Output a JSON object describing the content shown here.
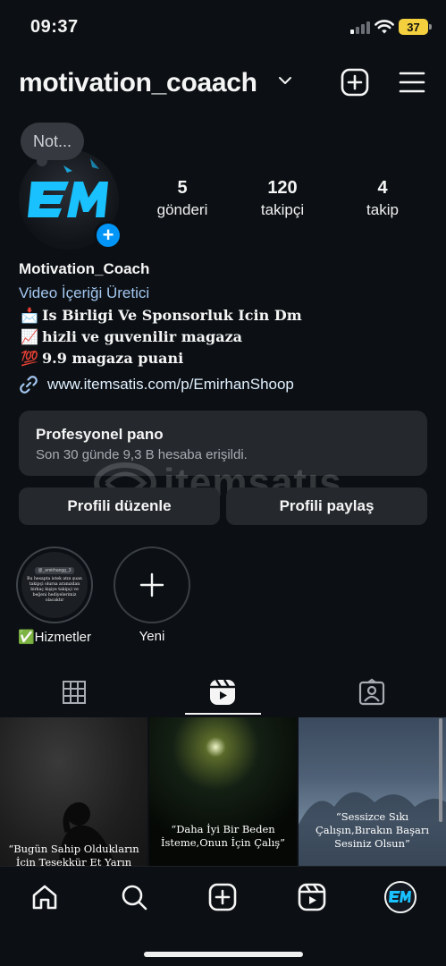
{
  "status_bar": {
    "time": "09:37",
    "battery": "37"
  },
  "header": {
    "username": "motivation_coaach"
  },
  "profile": {
    "note": "Not...",
    "avatar_text": "EM",
    "stats": [
      {
        "value": "5",
        "label": "gönderi"
      },
      {
        "value": "120",
        "label": "takipçi"
      },
      {
        "value": "4",
        "label": "takip"
      }
    ],
    "name": "Motivation_Coach",
    "category": "Video İçeriği Üretici",
    "bio_lines": [
      {
        "emoji": "📩",
        "text": "Is Birligi Ve Sponsorluk Icin Dm"
      },
      {
        "emoji": "📈",
        "text": "hizli ve guvenilir magaza"
      },
      {
        "emoji": "💯",
        "text": "9.9 magaza puani"
      }
    ],
    "link": "www.itemsatis.com/p/EmirhanShoop"
  },
  "dashboard": {
    "title": "Profesyonel pano",
    "subtitle": "Son 30 günde 9,3 B hesaba erişildi."
  },
  "buttons": {
    "edit": "Profili düzenle",
    "share": "Profili paylaş"
  },
  "watermark": {
    "text": "itemsatış"
  },
  "highlights": [
    {
      "label": "Hizmetler",
      "label_emoji": "✅",
      "thumb_handle": "@_emirhangg_3",
      "thumb_text": "Bu hesapta istek atın şuan takipçi olursa aranızdan birkaç kişiye takipçi ve beğeni hediyelerimiz olacaktır"
    },
    {
      "label": "Yeni"
    }
  ],
  "posts": [
    {
      "caption": "“Bugün Sahip Oldukların İçin Teşekkür Et Yarın"
    },
    {
      "caption": "“Daha İyi Bir Beden İsteme,Onun İçin Çalış”"
    },
    {
      "caption": "“Sessizce Sıkı Çalışın,Bırakın Başarı Sesiniz Olsun”"
    }
  ],
  "icons": {
    "tabs": [
      "grid-icon",
      "reels-icon",
      "tagged-icon"
    ],
    "nav": [
      "home-icon",
      "search-icon",
      "create-icon",
      "reels-icon",
      "profile-avatar"
    ]
  },
  "colors": {
    "background": "#0c1014",
    "accent": "#0095f6",
    "brand_cyan": "#19c2ff",
    "category_blue": "#a3c6f0"
  }
}
